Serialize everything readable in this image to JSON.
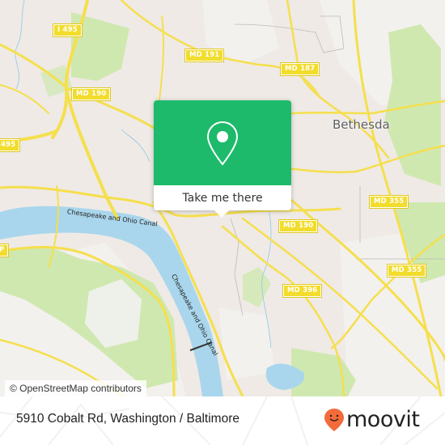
{
  "map": {
    "place_label": "Bethesda",
    "road_shields": [
      {
        "id": "i495-north",
        "label": "I 495"
      },
      {
        "id": "md191",
        "label": "MD 191"
      },
      {
        "id": "md187",
        "label": "MD 187"
      },
      {
        "id": "md190-west",
        "label": "MD 190"
      },
      {
        "id": "i495-west",
        "label": "495"
      },
      {
        "id": "md355-north",
        "label": "MD 355"
      },
      {
        "id": "md190-east",
        "label": "MD 190"
      },
      {
        "id": "md355-south",
        "label": "MD 355"
      },
      {
        "id": "md396",
        "label": "MD 396"
      },
      {
        "id": "gwp",
        "label": "P"
      }
    ],
    "water_labels": [
      {
        "id": "canal-upper",
        "label": "Chesapeake and Ohio Canal"
      },
      {
        "id": "canal-lower",
        "label": "Chesapeake and Ohio Canal"
      }
    ],
    "attribution": "© OpenStreetMap contributors",
    "colors": {
      "land": "#efeae6",
      "park": "#cfe8b0",
      "water": "#a9d6ec",
      "road": "#f5df4d",
      "shield": "#f2dc2c"
    }
  },
  "popup": {
    "icon": "map-pin-icon",
    "cta_label": "Take me there",
    "color": "#1dba6b"
  },
  "footer": {
    "address": "5910 Cobalt Rd, Washington / Baltimore",
    "brand": "moovit",
    "brand_icon": "moovit-pin-smile-icon",
    "brand_color": "#f26b3a"
  }
}
